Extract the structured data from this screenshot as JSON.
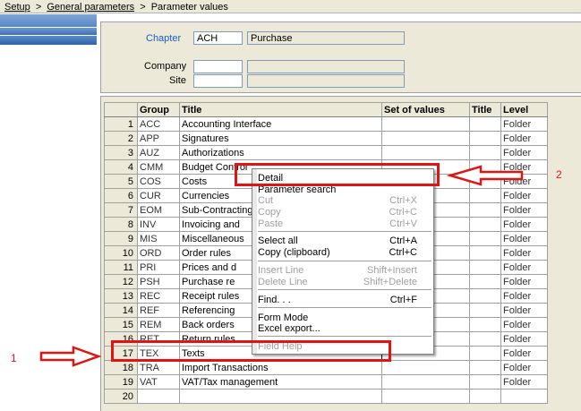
{
  "breadcrumb": {
    "setup": "Setup",
    "general": "General parameters",
    "current": "Parameter values",
    "separator": ">"
  },
  "header": {
    "chapter_label": "Chapter",
    "chapter_code": "ACH",
    "chapter_name": "Purchase",
    "company_label": "Company",
    "company_code": "",
    "company_name": "",
    "site_label": "Site",
    "site_code": "",
    "site_name": ""
  },
  "grid": {
    "columns": [
      "",
      "Group",
      "Title",
      "Set of values",
      "Title",
      "Level"
    ],
    "rows": [
      {
        "num": "1",
        "group": "ACC",
        "title": "Accounting Interface",
        "set": "",
        "title2": "",
        "level": "Folder"
      },
      {
        "num": "2",
        "group": "APP",
        "title": "Signatures",
        "set": "",
        "title2": "",
        "level": "Folder"
      },
      {
        "num": "3",
        "group": "AUZ",
        "title": "Authorizations",
        "set": "",
        "title2": "",
        "level": "Folder"
      },
      {
        "num": "4",
        "group": "CMM",
        "title": "Budget Control",
        "set": "",
        "title2": "",
        "level": "Folder"
      },
      {
        "num": "5",
        "group": "COS",
        "title": "Costs",
        "set": "",
        "title2": "",
        "level": "Folder"
      },
      {
        "num": "6",
        "group": "CUR",
        "title": "Currencies",
        "set": "",
        "title2": "",
        "level": "Folder"
      },
      {
        "num": "7",
        "group": "EOM",
        "title": "Sub-Contracting",
        "set": "",
        "title2": "",
        "level": "Folder"
      },
      {
        "num": "8",
        "group": "INV",
        "title": "Invoicing and",
        "set": "",
        "title2": "",
        "level": "Folder"
      },
      {
        "num": "9",
        "group": "MIS",
        "title": "Miscellaneous",
        "set": "",
        "title2": "",
        "level": "Folder"
      },
      {
        "num": "10",
        "group": "ORD",
        "title": "Order rules",
        "set": "",
        "title2": "",
        "level": "Folder"
      },
      {
        "num": "11",
        "group": "PRI",
        "title": "Prices and d",
        "set": "",
        "title2": "",
        "level": "Folder"
      },
      {
        "num": "12",
        "group": "PSH",
        "title": "Purchase re",
        "set": "",
        "title2": "",
        "level": "Folder"
      },
      {
        "num": "13",
        "group": "REC",
        "title": "Receipt rules",
        "set": "",
        "title2": "",
        "level": "Folder"
      },
      {
        "num": "14",
        "group": "REF",
        "title": "Referencing",
        "set": "",
        "title2": "",
        "level": "Folder"
      },
      {
        "num": "15",
        "group": "REM",
        "title": "Back orders",
        "set": "",
        "title2": "",
        "level": "Folder"
      },
      {
        "num": "16",
        "group": "RET",
        "title": "Return rules",
        "set": "",
        "title2": "",
        "level": "Folder"
      },
      {
        "num": "17",
        "group": "TEX",
        "title": "Texts",
        "set": "",
        "title2": "",
        "level": "Folder"
      },
      {
        "num": "18",
        "group": "TRA",
        "title": "Import Transactions",
        "set": "",
        "title2": "",
        "level": "Folder"
      },
      {
        "num": "19",
        "group": "VAT",
        "title": "VAT/Tax management",
        "set": "",
        "title2": "",
        "level": "Folder"
      },
      {
        "num": "20",
        "group": "",
        "title": "",
        "set": "",
        "title2": "",
        "level": ""
      }
    ]
  },
  "context_menu": {
    "items": [
      {
        "label": "Detail",
        "shortcut": "",
        "disabled": false
      },
      {
        "label": "Parameter search",
        "shortcut": "",
        "disabled": false
      },
      {
        "label": "Cut",
        "shortcut": "Ctrl+X",
        "disabled": true
      },
      {
        "label": "Copy",
        "shortcut": "Ctrl+C",
        "disabled": true
      },
      {
        "label": "Paste",
        "shortcut": "Ctrl+V",
        "disabled": true
      },
      {
        "label": "Select all",
        "shortcut": "Ctrl+A",
        "disabled": false
      },
      {
        "label": "Copy (clipboard)",
        "shortcut": "Ctrl+C",
        "disabled": false
      },
      {
        "label": "Insert Line",
        "shortcut": "Shift+Insert",
        "disabled": true
      },
      {
        "label": "Delete Line",
        "shortcut": "Shift+Delete",
        "disabled": true
      },
      {
        "label": "Find. . .",
        "shortcut": "Ctrl+F",
        "disabled": false
      },
      {
        "label": "Form Mode",
        "shortcut": "",
        "disabled": false
      },
      {
        "label": "Excel export...",
        "shortcut": "",
        "disabled": false
      },
      {
        "label": "Field Help",
        "shortcut": "",
        "disabled": true
      }
    ]
  },
  "annotations": {
    "label_1": "1",
    "label_2": "2",
    "color": "#e11414"
  }
}
